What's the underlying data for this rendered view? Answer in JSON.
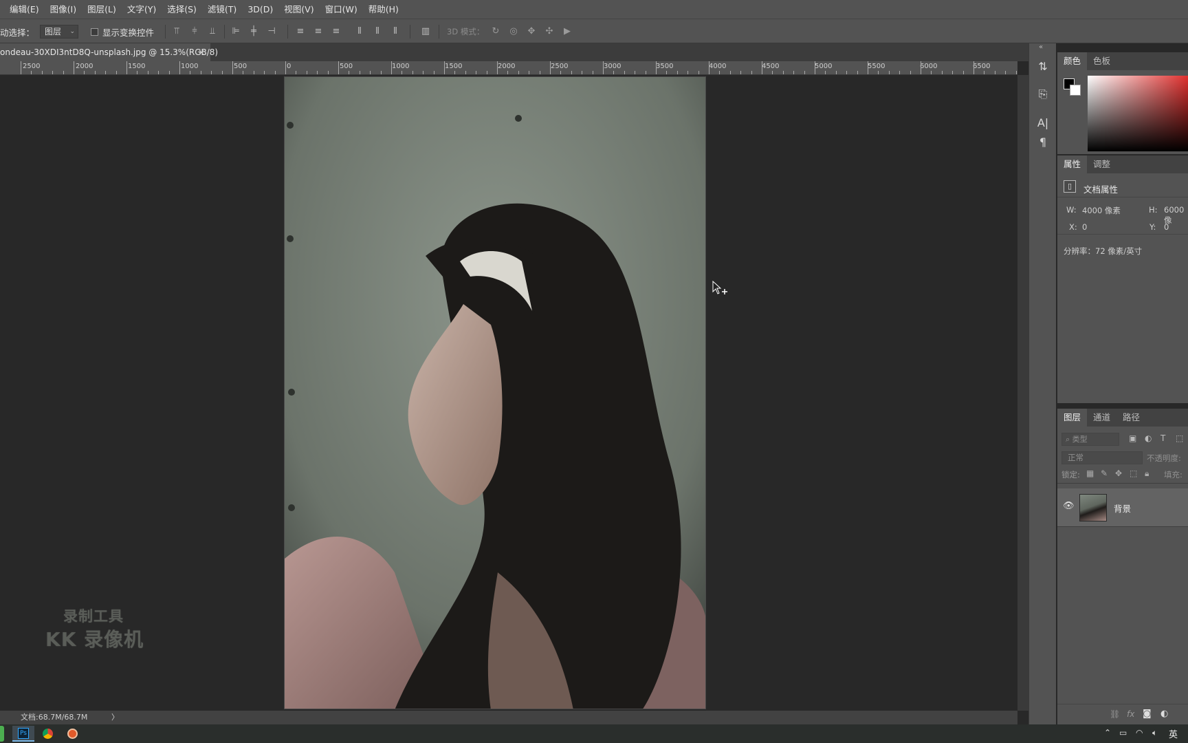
{
  "menu": [
    "编辑(E)",
    "图像(I)",
    "图层(L)",
    "文字(Y)",
    "选择(S)",
    "滤镜(T)",
    "3D(D)",
    "视图(V)",
    "窗口(W)",
    "帮助(H)"
  ],
  "options": {
    "auto_select_label": "动选择：",
    "auto_select_value": "图层",
    "show_transform": "显示变换控件",
    "mode_3d": "3D 模式："
  },
  "doc_tab": {
    "title": "ondeau-30XDI3ntD8Q-unsplash.jpg @ 15.3%(RGB/8)",
    "close": "×"
  },
  "ruler": [
    "2500",
    "2000",
    "1500",
    "1000",
    "500",
    "0",
    "500",
    "1000",
    "1500",
    "2000",
    "2500",
    "3000",
    "3500",
    "4000",
    "4500",
    "5000",
    "5500",
    "6000",
    "6500"
  ],
  "color_panel": {
    "tabs": [
      "颜色",
      "色板"
    ]
  },
  "properties_panel": {
    "tabs": [
      "属性",
      "调整"
    ],
    "header": "文档属性",
    "w_label": "W:",
    "w_value": "4000 像素",
    "h_label": "H:",
    "h_value": "6000 像",
    "x_label": "X:",
    "x_value": "0",
    "y_label": "Y:",
    "y_value": "0",
    "resolution": "分辨率：72 像素/英寸"
  },
  "layers_panel": {
    "tabs": [
      "图层",
      "通道",
      "路径"
    ],
    "filter_placeholder": "类型",
    "blend_mode": "正常",
    "opacity_label": "不透明度:",
    "lock_label": "锁定:",
    "fill_label": "填充:",
    "layer_name": "背景"
  },
  "status": {
    "doc": "文档:68.7M/68.7M",
    "arrow": "〉"
  },
  "watermark": {
    "line1": "录制工具",
    "line2": "KK 录像机"
  },
  "taskbar": {
    "ime": "英"
  }
}
